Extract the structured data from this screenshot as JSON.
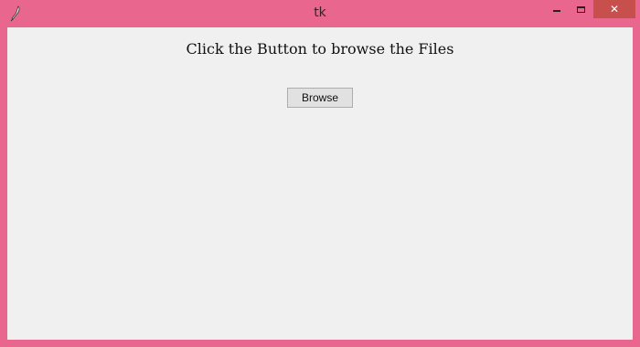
{
  "window": {
    "title": "tk",
    "icon": "tk-feather-icon",
    "frame_color": "#e9678f",
    "close_color": "#c7504d"
  },
  "controls": {
    "minimize": "minimize-icon",
    "maximize": "maximize-icon",
    "close": "close-icon",
    "close_glyph": "✕"
  },
  "main": {
    "heading": "Click the Button to browse the Files",
    "browse_label": "Browse"
  }
}
